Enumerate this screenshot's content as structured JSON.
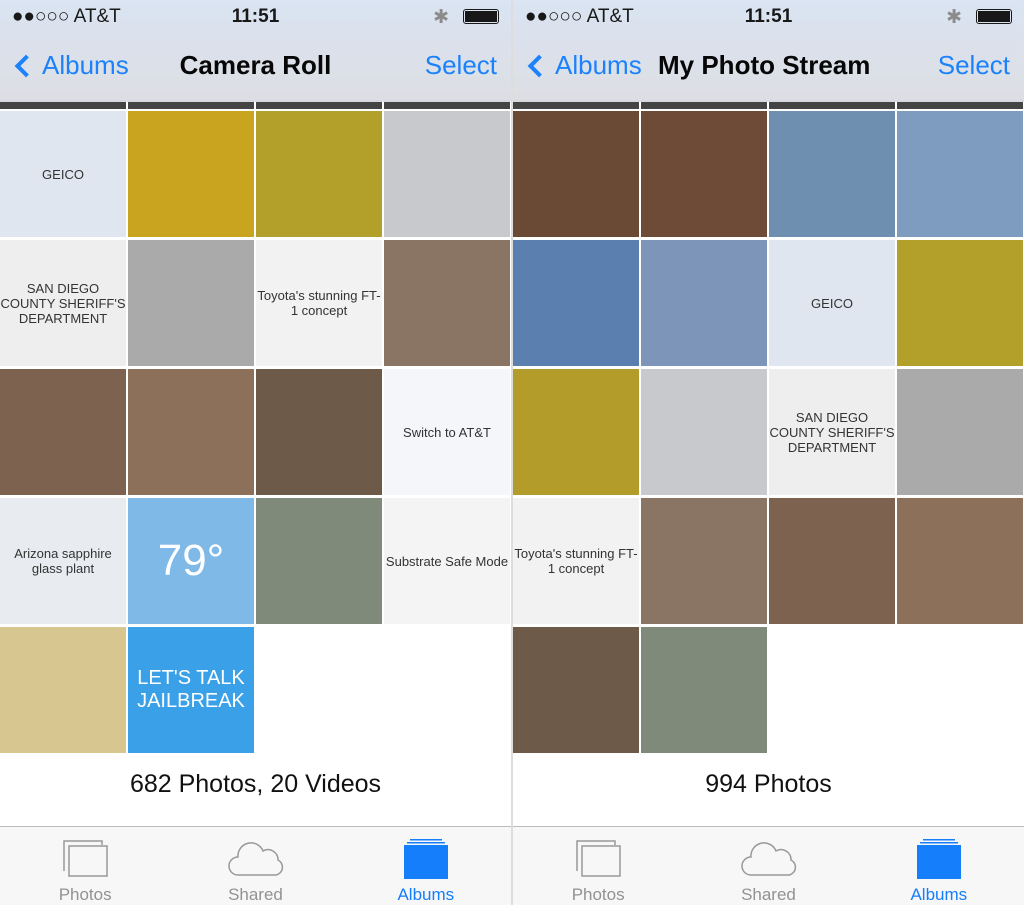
{
  "status": {
    "carrier": "●●○○○ AT&T",
    "time": "11:51",
    "bluetooth": "✱"
  },
  "colors": {
    "accent": "#157efb"
  },
  "screens": [
    {
      "back_label": "Albums",
      "title": "Camera Roll",
      "select_label": "Select",
      "count": "682 Photos, 20 Videos",
      "tiles": [
        {
          "c": "#dfe6ef",
          "t": "GEICO"
        },
        {
          "c": "#c9a51f",
          "t": ""
        },
        {
          "c": "#b3a02a",
          "t": ""
        },
        {
          "c": "#c8c9cc",
          "t": ""
        },
        {
          "c": "#eeeeee",
          "t": "SAN DIEGO COUNTY SHERIFF'S DEPARTMENT"
        },
        {
          "c": "#a9aaa9",
          "t": ""
        },
        {
          "c": "#f2f2f2",
          "t": "Toyota's stunning FT-1 concept"
        },
        {
          "c": "#8a7565",
          "t": ""
        },
        {
          "c": "#7d6250",
          "t": ""
        },
        {
          "c": "#8c705a",
          "t": ""
        },
        {
          "c": "#6e5a48",
          "t": ""
        },
        {
          "c": "#f4f6fa",
          "t": "Switch to AT&T"
        },
        {
          "c": "#e8ecf0",
          "t": "Arizona sapphire glass plant"
        },
        {
          "c": "#7fb9e8",
          "t": "79°"
        },
        {
          "c": "#7f8a7a",
          "t": ""
        },
        {
          "c": "#f4f4f4",
          "t": "Substrate Safe Mode"
        },
        {
          "c": "#d8c690",
          "t": ""
        },
        {
          "c": "#3aa0e8",
          "t": "LET'S TALK JAILBREAK"
        }
      ]
    },
    {
      "back_label": "Albums",
      "title": "My Photo Stream",
      "select_label": "Select",
      "count": "994 Photos",
      "tiles": [
        {
          "c": "#6b4a35",
          "t": ""
        },
        {
          "c": "#6e4b36",
          "t": ""
        },
        {
          "c": "#6f8fb0",
          "t": ""
        },
        {
          "c": "#7e9cc0",
          "t": ""
        },
        {
          "c": "#5b7fae",
          "t": ""
        },
        {
          "c": "#7c95b8",
          "t": ""
        },
        {
          "c": "#dfe6ef",
          "t": "GEICO"
        },
        {
          "c": "#b3a02a",
          "t": ""
        },
        {
          "c": "#b39c2a",
          "t": ""
        },
        {
          "c": "#c8c9cc",
          "t": ""
        },
        {
          "c": "#eeeeee",
          "t": "SAN DIEGO COUNTY SHERIFF'S DEPARTMENT"
        },
        {
          "c": "#a9aaa9",
          "t": ""
        },
        {
          "c": "#f2f2f2",
          "t": "Toyota's stunning FT-1 concept"
        },
        {
          "c": "#8a7565",
          "t": ""
        },
        {
          "c": "#7d6250",
          "t": ""
        },
        {
          "c": "#8c705a",
          "t": ""
        },
        {
          "c": "#6e5a48",
          "t": ""
        },
        {
          "c": "#7f8a7a",
          "t": ""
        }
      ]
    }
  ],
  "tabs": [
    {
      "label": "Photos",
      "icon": "photos-icon"
    },
    {
      "label": "Shared",
      "icon": "cloud-icon"
    },
    {
      "label": "Albums",
      "icon": "albums-icon",
      "active": true
    }
  ]
}
